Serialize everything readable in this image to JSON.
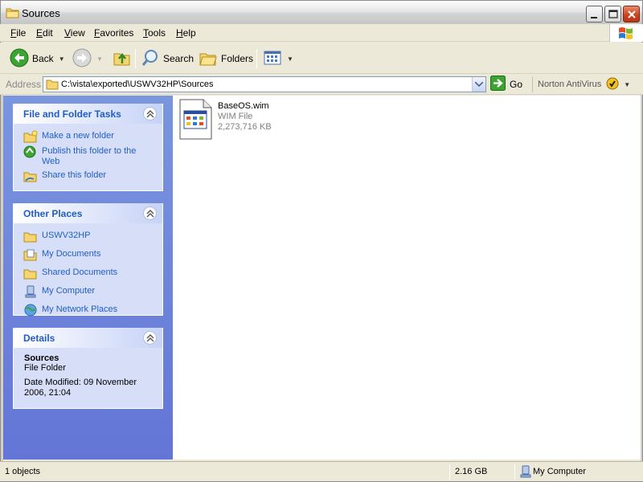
{
  "window": {
    "title": "Sources",
    "icon": "folder-icon"
  },
  "menu": {
    "items": [
      {
        "label": "File",
        "accel": "F",
        "rest": "ile"
      },
      {
        "label": "Edit",
        "accel": "E",
        "rest": "dit"
      },
      {
        "label": "View",
        "accel": "V",
        "rest": "iew"
      },
      {
        "label": "Favorites",
        "accel": "F",
        "rest": "avorites"
      },
      {
        "label": "Tools",
        "accel": "T",
        "rest": "ools"
      },
      {
        "label": "Help",
        "accel": "H",
        "rest": "elp"
      }
    ]
  },
  "toolbar": {
    "back_label": "Back",
    "search_label": "Search",
    "folders_label": "Folders"
  },
  "address": {
    "label": "Address",
    "path": "C:\\vista\\exported\\USWV32HP\\Sources",
    "go_label": "Go",
    "norton_label": "Norton AntiVirus"
  },
  "sidebar": {
    "tasks": {
      "title": "File and Folder Tasks",
      "items": [
        {
          "label": "Make a new folder",
          "icon": "new-folder-icon"
        },
        {
          "label": "Publish this folder to the Web",
          "icon": "publish-web-icon"
        },
        {
          "label": "Share this folder",
          "icon": "share-folder-icon"
        }
      ]
    },
    "places": {
      "title": "Other Places",
      "items": [
        {
          "label": "USWV32HP",
          "icon": "folder-icon"
        },
        {
          "label": "My Documents",
          "icon": "my-documents-icon"
        },
        {
          "label": "Shared Documents",
          "icon": "shared-folder-icon"
        },
        {
          "label": "My Computer",
          "icon": "computer-icon"
        },
        {
          "label": "My Network Places",
          "icon": "network-icon"
        }
      ]
    },
    "details": {
      "title": "Details",
      "name": "Sources",
      "type": "File Folder",
      "modified": "Date Modified: 09 November 2006, 21:04"
    }
  },
  "files": [
    {
      "name": "BaseOS.wim",
      "type": "WIM File",
      "size": "2,273,716 KB",
      "icon": "wim-file-icon"
    }
  ],
  "status": {
    "objects": "1 objects",
    "size": "2.16 GB",
    "zone": "My Computer"
  },
  "colors": {
    "task_link": "#215DC6",
    "sidebar_bg": "#6375D6",
    "panel_bg": "#D6DFF7"
  }
}
